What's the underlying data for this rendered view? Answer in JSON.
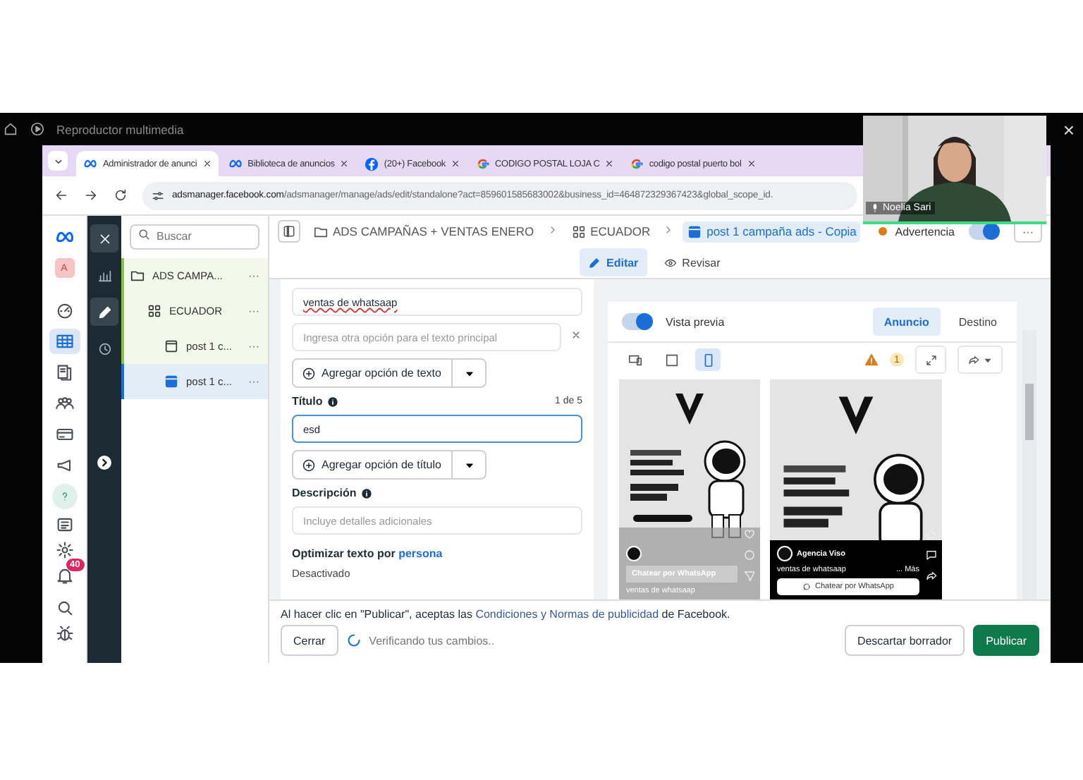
{
  "media_player": {
    "title": "Reproductor multimedia",
    "close": "×"
  },
  "browser": {
    "tabs": [
      {
        "title": "Administrador de anunci",
        "kind": "meta",
        "selected": true
      },
      {
        "title": "Biblioteca de anuncios",
        "kind": "meta",
        "selected": false
      },
      {
        "title": "(20+) Facebook",
        "kind": "facebook",
        "selected": false
      },
      {
        "title": "CODIGO POSTAL LOJA C",
        "kind": "google",
        "selected": false
      },
      {
        "title": "codigo postal puerto bol",
        "kind": "google",
        "selected": false
      }
    ],
    "url_host": "adsmanager.facebook.com",
    "url_path": "/adsmanager/manage/ads/edit/standalone?act=859601585683002&business_id=464872329367423&global_scope_id."
  },
  "webcam": {
    "name": "Noelia Sari"
  },
  "rail": {
    "avatar": "A",
    "nav": [
      {
        "selected": false
      },
      {
        "selected": true
      },
      {
        "selected": false
      },
      {
        "selected": false
      },
      {
        "selected": false
      },
      {
        "selected": false
      }
    ],
    "notification_badge": "40"
  },
  "tools": [
    {
      "selected": true
    },
    {
      "selected": false
    },
    {
      "selected": true
    },
    {
      "selected": false
    }
  ],
  "tree": {
    "search_placeholder": "Buscar",
    "items": [
      {
        "label": "ADS CAMPA...",
        "kind": "campaign",
        "selected": false,
        "children": [
          {
            "label": "ECUADOR",
            "kind": "adset",
            "selected": false,
            "children": [
              {
                "label": "post 1 c...",
                "kind": "ad",
                "selected": false
              },
              {
                "label": "post 1 c...",
                "kind": "ad",
                "selected": true
              }
            ]
          }
        ]
      }
    ],
    "more": "···"
  },
  "breadcrumb": [
    {
      "label": "ADS CAMPAÑAS + VENTAS ENERO",
      "kind": "campaign",
      "selected": false
    },
    {
      "label": "ECUADOR",
      "kind": "adset",
      "selected": false
    },
    {
      "label": "post 1 campaña ads - Copia",
      "kind": "ad",
      "selected": true
    }
  ],
  "status": {
    "label": "Advertencia",
    "color": "#e07b1a",
    "on": true
  },
  "mode_tabs": [
    {
      "label": "Editar",
      "kind": "edit",
      "selected": true
    },
    {
      "label": "Revisar",
      "kind": "review",
      "selected": false
    }
  ],
  "form": {
    "primary_text_value": "ventas de whatsaap",
    "primary_text_placeholder": "Ingresa otra opción para el texto principal",
    "add_text_option": "Agregar opción de texto",
    "title_label": "Título",
    "title_counter": "1 de 5",
    "title_value": "esd",
    "add_title_option": "Agregar opción de título",
    "description_label": "Descripción",
    "description_placeholder": "Incluye detalles adicionales",
    "optimize_label": "Optimizar texto por ",
    "optimize_link": "persona",
    "optimize_value": "Desactivado"
  },
  "preview": {
    "toggle_label": "Vista previa",
    "toggle_on": true,
    "tabs": [
      {
        "label": "Anuncio",
        "selected": true
      },
      {
        "label": "Destino",
        "selected": false
      }
    ],
    "devices": [
      {
        "kind": "desktop",
        "selected": false
      },
      {
        "kind": "square",
        "selected": false
      },
      {
        "kind": "phone",
        "selected": true
      }
    ],
    "warning_count": "1",
    "ads": [
      {
        "kind": "reel",
        "caption": "ventas de whatsaap",
        "cta": "Chatear por WhatsApp"
      },
      {
        "kind": "story",
        "account": "Agencia Viso",
        "caption": "ventas de whatsaap",
        "more": "... Más",
        "cta": "Chatear por WhatsApp"
      }
    ]
  },
  "footer": {
    "notice_before": "Al hacer clic en \"Publicar\", aceptas las ",
    "notice_link": "Condiciones y Normas de publicidad",
    "notice_after": " de Facebook.",
    "close": "Cerrar",
    "progress": "Verificando tus cambios..",
    "discard": "Descartar borrador",
    "publish": "Publicar"
  }
}
